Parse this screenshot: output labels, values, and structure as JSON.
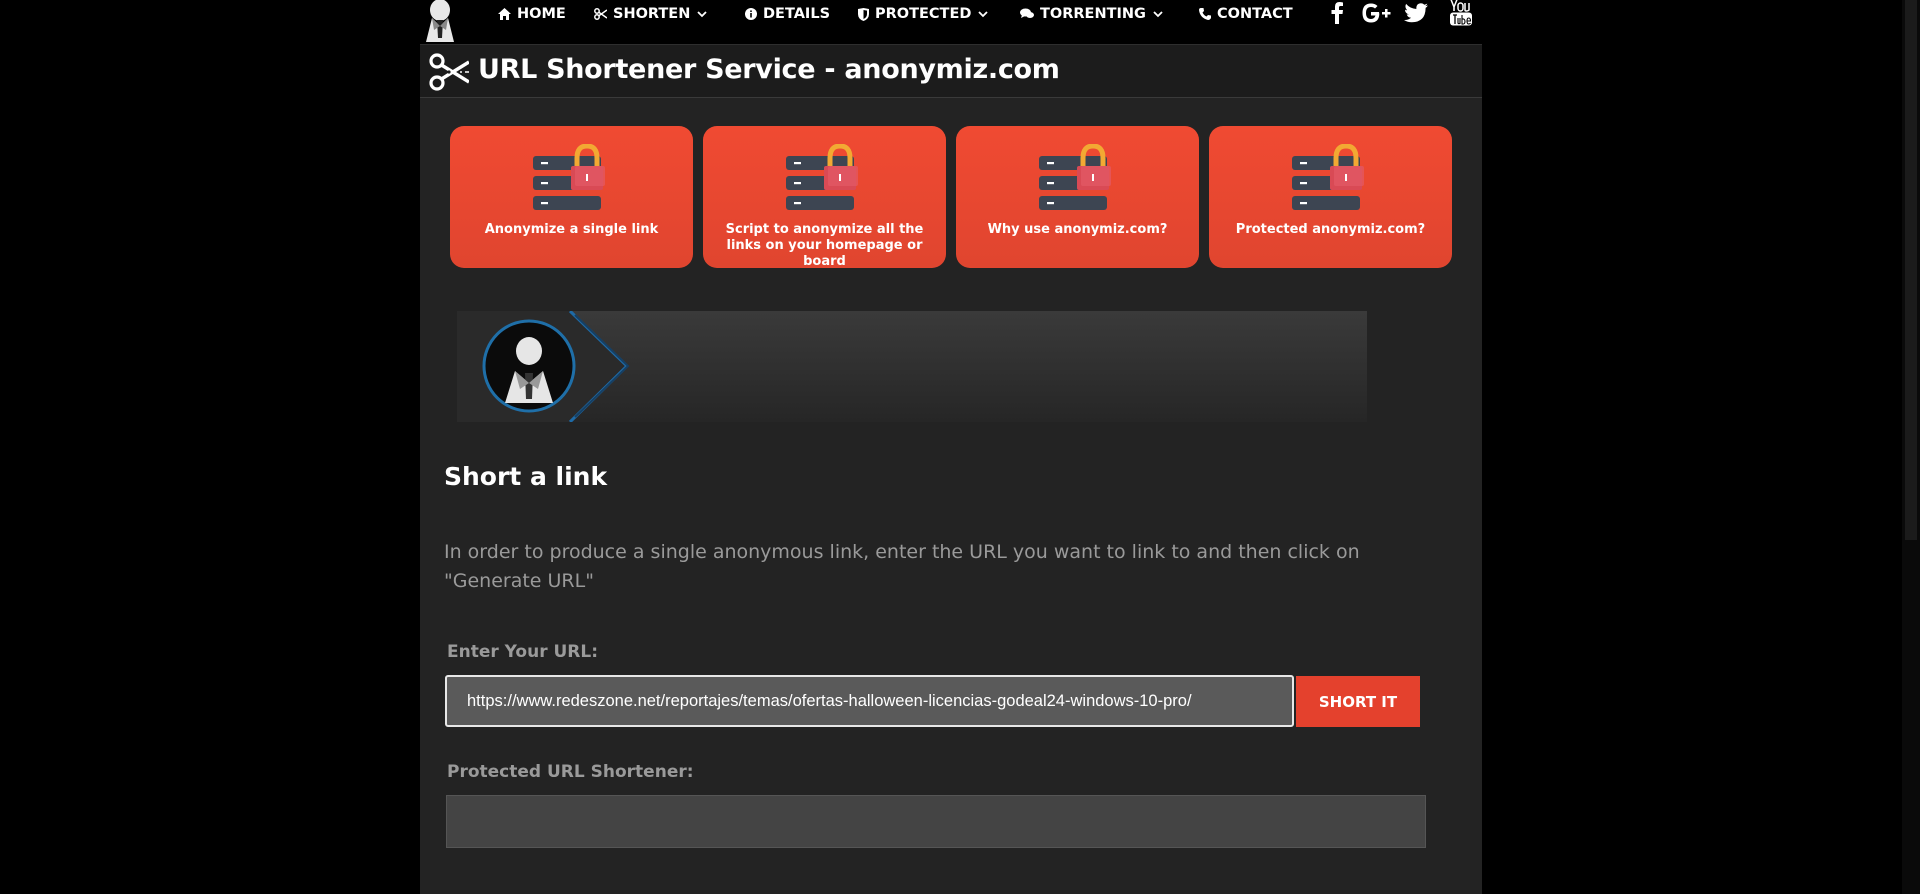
{
  "nav": {
    "items": [
      {
        "label": "HOME",
        "icon": "home-icon",
        "dropdown": false
      },
      {
        "label": "SHORTEN",
        "icon": "scissors-icon",
        "dropdown": true
      },
      {
        "label": "DETAILS",
        "icon": "info-icon",
        "dropdown": false
      },
      {
        "label": "PROTECTED",
        "icon": "shield-icon",
        "dropdown": true
      },
      {
        "label": "TORRENTING",
        "icon": "comments-icon",
        "dropdown": true
      },
      {
        "label": "CONTACT",
        "icon": "phone-icon",
        "dropdown": false
      }
    ],
    "social": [
      "facebook-icon",
      "google-plus-icon",
      "twitter-icon",
      "youtube-icon"
    ]
  },
  "header": {
    "title": "URL Shortener Service - anonymiz.com"
  },
  "cards": [
    {
      "label": "Anonymize a single link"
    },
    {
      "label": "Script to anonymize all the links on your homepage or board"
    },
    {
      "label": "Why use anonymiz.com?"
    },
    {
      "label": "Protected anonymiz.com?"
    }
  ],
  "form": {
    "heading": "Short a link",
    "intro": "In order to produce a single anonymous link, enter the URL you want to link to and then click on \"Generate URL\"",
    "url_label": "Enter Your URL:",
    "url_value": "https://www.redeszone.net/reportajes/temas/ofertas-halloween-licencias-godeal24-windows-10-pro/",
    "button_label": "SHORT IT",
    "output_label": "Protected URL Shortener:",
    "output_value": ""
  },
  "colors": {
    "accent": "#e4412d",
    "card": "#ee4a31",
    "panel": "#232323",
    "banner_ring": "#1f6fa8"
  }
}
